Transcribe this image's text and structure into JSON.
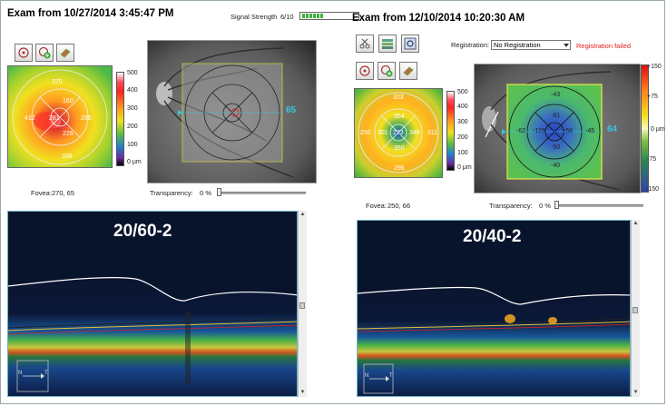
{
  "left": {
    "exam_title": "Exam from 10/27/2014 3:45:47 PM",
    "signal_label": "Signal Strength",
    "signal_value": "6/10",
    "signal_level": 0.6,
    "colorbar_labels": [
      "500",
      "400",
      "300",
      "200",
      "100",
      "0 µm"
    ],
    "sector_values": [
      "370",
      "160",
      "412",
      "281",
      "296",
      "226",
      "336"
    ],
    "scan_number": "65",
    "fovea_label": "Fovea:",
    "fovea_value": "270, 65",
    "transparency_label": "Transparency:",
    "transparency_value": "0 %",
    "acuity": "20/60-2",
    "orientation": {
      "nasal": "N",
      "temporal": "T"
    }
  },
  "right": {
    "exam_title": "Exam from 12/10/2014 10:20:30 AM",
    "registration_label": "Registration:",
    "registration_value": "No Registration",
    "registration_status": "Registration failed",
    "colorbar_labels": [
      "500",
      "400",
      "300",
      "200",
      "100",
      "0 µm"
    ],
    "sector_values": [
      "323",
      "354",
      "250",
      "301",
      "273",
      "348",
      "311",
      "350",
      "296"
    ],
    "diff_colorbar_labels": [
      "+150",
      "+75",
      "0 µm",
      "-75",
      "-150"
    ],
    "diff_values": [
      "-43",
      "-81",
      "-62",
      "-129",
      "-56",
      "-45",
      "-50",
      "-40"
    ],
    "scan_number": "64",
    "fovea_label": "Fovea:",
    "fovea_value": "250, 66",
    "transparency_label": "Transparency:",
    "transparency_value": "0 %",
    "acuity": "20/40-2",
    "orientation": {
      "nasal": "N",
      "temporal": "T"
    }
  },
  "colors": {
    "fundus_overlay": "#e8e84a",
    "scan_line": "#37c8e0",
    "registration_failed": "#e0201a",
    "signal_green": "#3db33d"
  },
  "icons": [
    "settings-icon",
    "target-icon",
    "layers-icon",
    "target-add-icon",
    "eraser-icon",
    "scissors-icon"
  ]
}
